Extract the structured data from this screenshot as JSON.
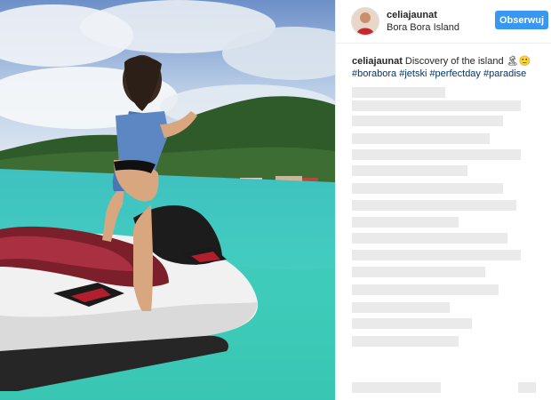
{
  "post": {
    "username": "celiajaunat",
    "location": "Bora Bora Island",
    "follow_label": "Obserwuj"
  },
  "caption": {
    "username": "celiajaunat",
    "text": "Discovery of the island 🏝🙂",
    "hashtags": "#borabora #jetski #perfectday #paradise"
  },
  "colors": {
    "follow_button": "#3897f0",
    "hashtag": "#003569",
    "text": "#262626"
  }
}
